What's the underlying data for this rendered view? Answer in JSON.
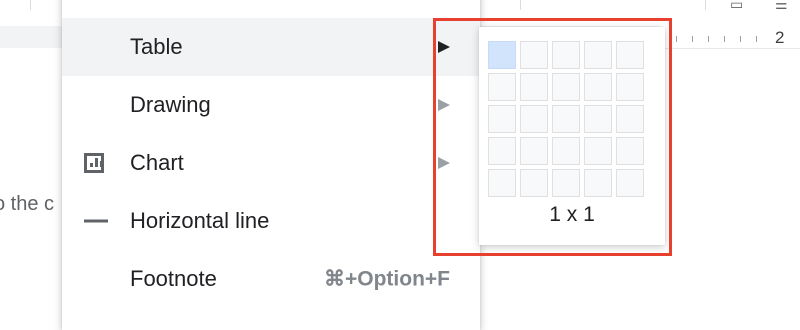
{
  "document": {
    "body_text_fragment": "o the c",
    "ruler_number": "2"
  },
  "insert_menu": {
    "items": [
      {
        "label": "Table",
        "has_submenu": true,
        "highlighted": true
      },
      {
        "label": "Drawing",
        "has_submenu": true
      },
      {
        "label": "Chart",
        "icon": "chart-icon",
        "has_submenu": true
      },
      {
        "label": "Horizontal line",
        "icon": "horizontal-line-icon"
      },
      {
        "label": "Footnote",
        "shortcut": "⌘+Option+F"
      }
    ]
  },
  "table_picker": {
    "rows": 5,
    "cols": 5,
    "selected_rows": 1,
    "selected_cols": 1,
    "size_label": "1 x 1"
  },
  "colors": {
    "highlight_border": "#e8402f",
    "selected_cell": "#d2e3fc",
    "menu_hover": "#f1f3f4"
  }
}
